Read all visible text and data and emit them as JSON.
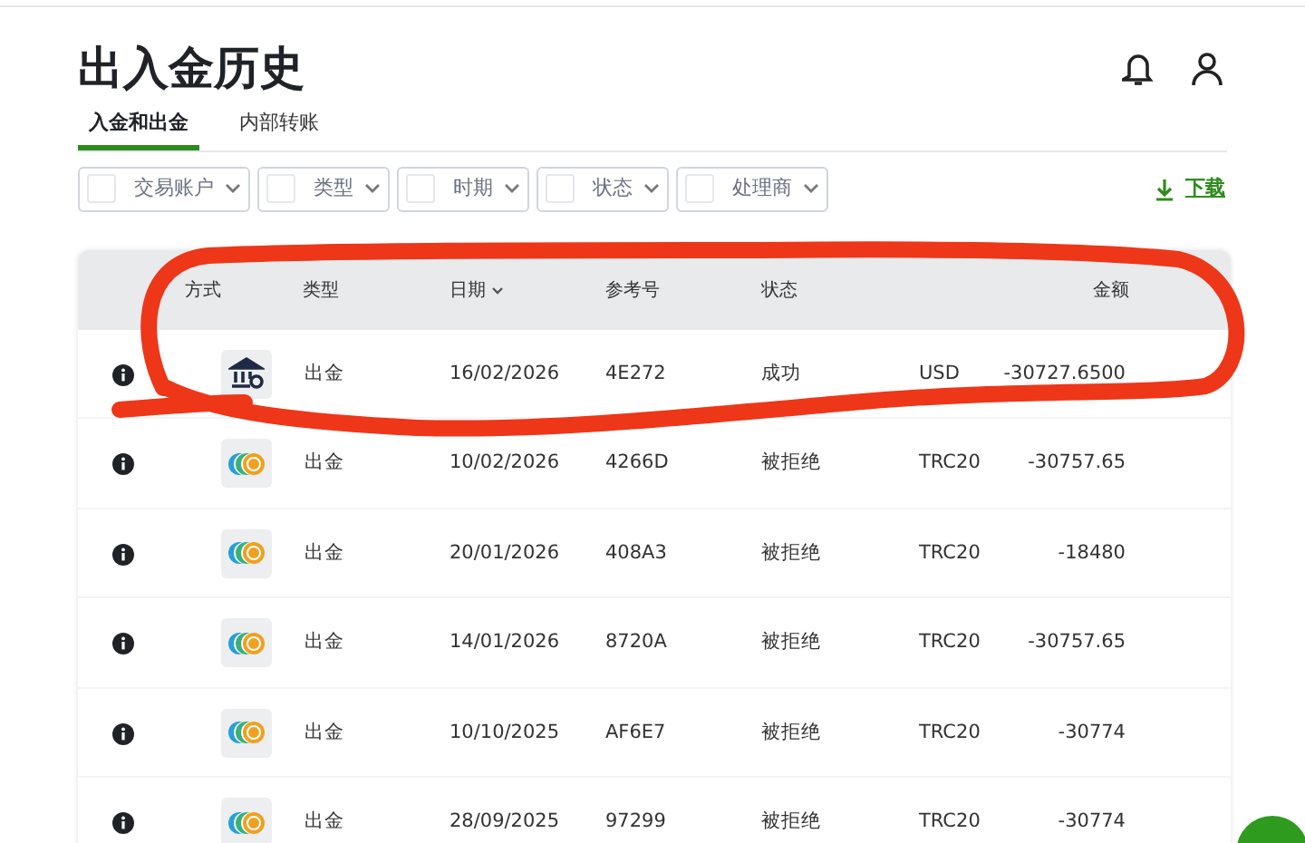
{
  "page": {
    "title": "出入金历史"
  },
  "tabs": [
    {
      "label": "入金和出金",
      "selected": true
    },
    {
      "label": "内部转账",
      "selected": false
    }
  ],
  "filters": [
    {
      "label": "交易账户",
      "checked": false
    },
    {
      "label": "类型",
      "checked": false
    },
    {
      "label": "时期",
      "checked": false
    },
    {
      "label": "状态",
      "checked": false
    },
    {
      "label": "处理商",
      "checked": false
    }
  ],
  "download": {
    "label": "下载"
  },
  "table": {
    "columns": [
      {
        "label": "方式"
      },
      {
        "label": "类型"
      },
      {
        "label": "日期",
        "sortable": true
      },
      {
        "label": "参考号"
      },
      {
        "label": "状态"
      },
      {
        "label": "金额"
      }
    ],
    "rows": [
      {
        "kind": "bank",
        "type": "出金",
        "date": "16/02/2026",
        "reference": "4E272",
        "status": "成功",
        "currency": "USD",
        "amount": "-30727.6500"
      },
      {
        "kind": "crypto",
        "type": "出金",
        "date": "10/02/2026",
        "reference": "4266D",
        "status": "被拒绝",
        "currency": "TRC20",
        "amount": "-30757.65"
      },
      {
        "kind": "crypto",
        "type": "出金",
        "date": "20/01/2026",
        "reference": "408A3",
        "status": "被拒绝",
        "currency": "TRC20",
        "amount": "-18480"
      },
      {
        "kind": "crypto",
        "type": "出金",
        "date": "14/01/2026",
        "reference": "8720A",
        "status": "被拒绝",
        "currency": "TRC20",
        "amount": "-30757.65"
      },
      {
        "kind": "crypto",
        "type": "出金",
        "date": "10/10/2025",
        "reference": "AF6E7",
        "status": "被拒绝",
        "currency": "TRC20",
        "amount": "-30774"
      },
      {
        "kind": "crypto",
        "type": "出金",
        "date": "28/09/2025",
        "reference": "97299",
        "status": "被拒绝",
        "currency": "TRC20",
        "amount": "-30774"
      }
    ]
  }
}
